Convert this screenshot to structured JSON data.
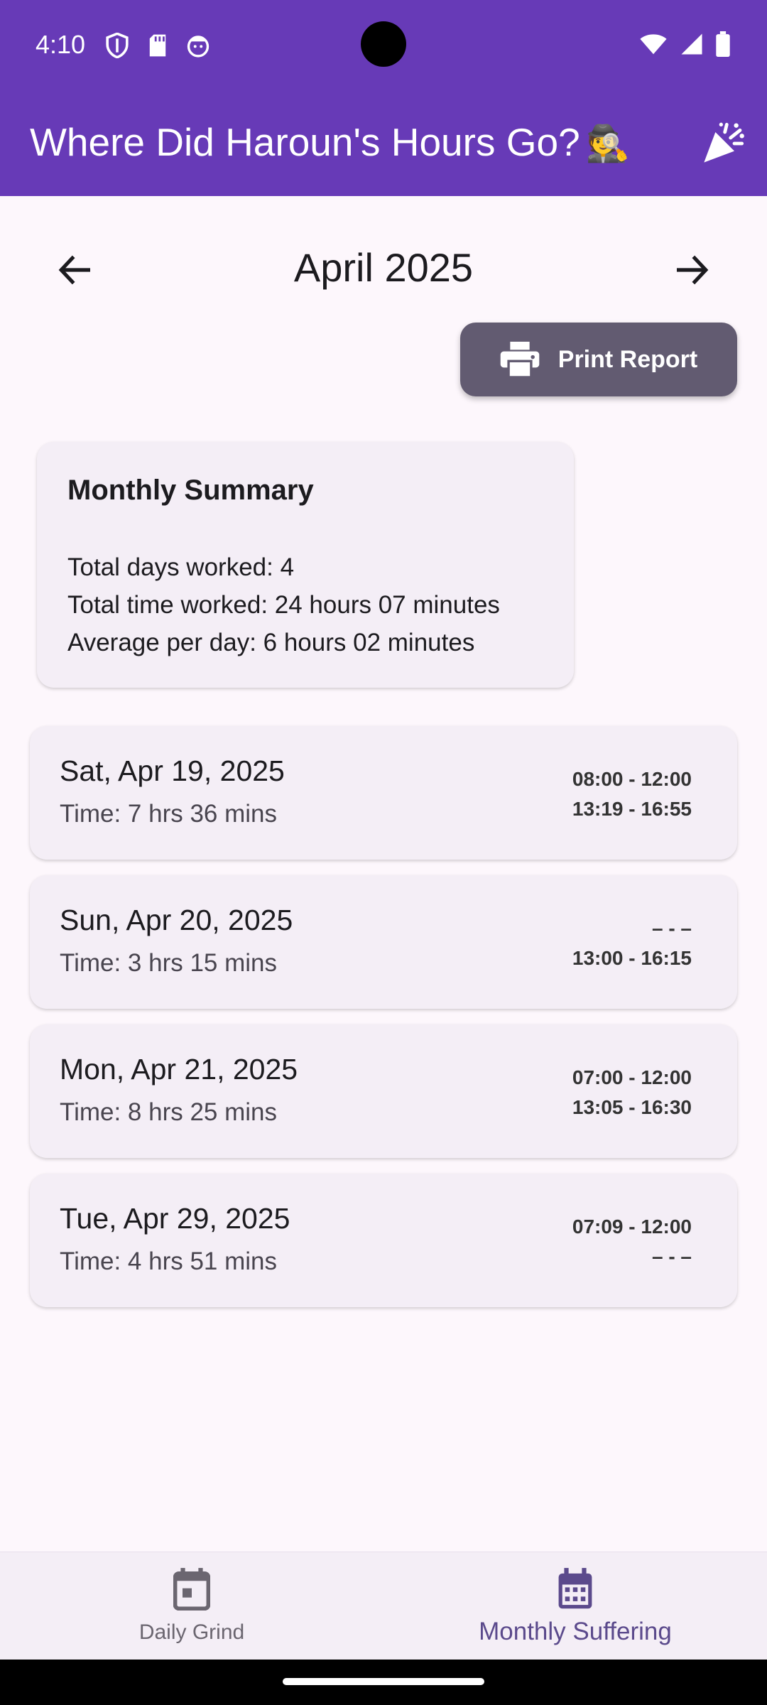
{
  "status_bar": {
    "time": "4:10",
    "left_icons": [
      "shield-icon",
      "sd-card-icon",
      "face-icon"
    ],
    "right_icons": [
      "wifi-icon",
      "signal-icon",
      "battery-icon"
    ]
  },
  "app_bar": {
    "title": "Where Did Haroun's Hours Go?",
    "title_emoji": "🕵",
    "action_icon": "party-popper-icon",
    "color": "#673AB7"
  },
  "month_nav": {
    "label": "April 2025",
    "prev_icon": "arrow-left-icon",
    "next_icon": "arrow-right-icon"
  },
  "print_button": {
    "label": "Print Report",
    "icon": "printer-icon",
    "color": "#625B71"
  },
  "summary": {
    "title": "Monthly Summary",
    "days_worked": "Total days worked: 4",
    "total_time": "Total time worked: 24 hours 07 minutes",
    "average": "Average per day: 6 hours 02 minutes"
  },
  "days": [
    {
      "date": "Sat, Apr 19, 2025",
      "time": "Time: 7 hrs 36 mins",
      "morning": "08:00 - 12:00",
      "afternoon": "13:19 - 16:55"
    },
    {
      "date": "Sun, Apr 20, 2025",
      "time": "Time: 3 hrs 15 mins",
      "morning": "– - –",
      "afternoon": "13:00 - 16:15"
    },
    {
      "date": "Mon, Apr 21, 2025",
      "time": "Time: 8 hrs 25 mins",
      "morning": "07:00 - 12:00",
      "afternoon": "13:05 - 16:30"
    },
    {
      "date": "Tue, Apr 29, 2025",
      "time": "Time: 4 hrs 51 mins",
      "morning": "07:09 - 12:00",
      "afternoon": "– - –"
    }
  ],
  "bottom_nav": {
    "tabs": [
      {
        "label": "Daily Grind",
        "icon": "calendar-day-icon",
        "selected": false
      },
      {
        "label": "Monthly Suffering",
        "icon": "calendar-month-icon",
        "selected": true
      }
    ]
  }
}
